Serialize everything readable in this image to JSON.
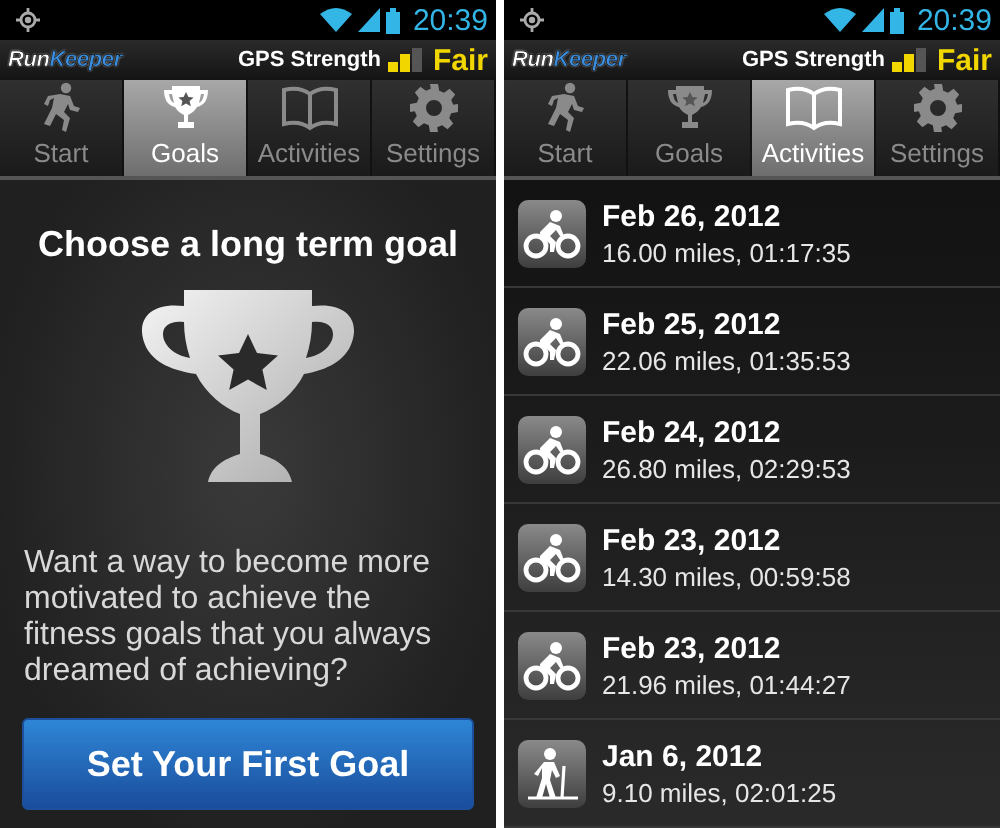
{
  "screens": [
    {
      "status_bar": {
        "time": "20:39"
      },
      "header": {
        "logo": [
          "Run",
          "Keeper"
        ],
        "gps_label": "GPS Strength",
        "gps_status": "Fair"
      },
      "tabs": [
        {
          "label": "Start",
          "kind": "runner",
          "selected": false
        },
        {
          "label": "Goals",
          "kind": "trophy",
          "selected": true
        },
        {
          "label": "Activities",
          "kind": "book",
          "selected": false
        },
        {
          "label": "Settings",
          "kind": "gear",
          "selected": false
        }
      ],
      "content": {
        "kind": "goals",
        "title": "Choose a long term goal",
        "text": "Want a way to become more motivated to achieve the fitness goals that you always dreamed of achieving?",
        "button": "Set Your First Goal"
      }
    },
    {
      "status_bar": {
        "time": "20:39"
      },
      "header": {
        "logo": [
          "Run",
          "Keeper"
        ],
        "gps_label": "GPS Strength",
        "gps_status": "Fair"
      },
      "tabs": [
        {
          "label": "Start",
          "kind": "runner",
          "selected": false
        },
        {
          "label": "Goals",
          "kind": "trophy",
          "selected": false
        },
        {
          "label": "Activities",
          "kind": "book",
          "selected": true
        },
        {
          "label": "Settings",
          "kind": "gear",
          "selected": false
        }
      ],
      "content": {
        "kind": "activities",
        "items": [
          {
            "kind": "cycling",
            "date": "Feb 26, 2012",
            "summary": "16.00 miles, 01:17:35"
          },
          {
            "kind": "cycling",
            "date": "Feb 25, 2012",
            "summary": "22.06 miles, 01:35:53"
          },
          {
            "kind": "cycling",
            "date": "Feb 24, 2012",
            "summary": "26.80 miles, 02:29:53"
          },
          {
            "kind": "cycling",
            "date": "Feb 23, 2012",
            "summary": "14.30 miles, 00:59:58"
          },
          {
            "kind": "cycling",
            "date": "Feb 23, 2012",
            "summary": "21.96 miles, 01:44:27"
          },
          {
            "kind": "hiking",
            "date": "Jan 6, 2012",
            "summary": "9.10 miles, 02:01:25"
          }
        ]
      }
    }
  ]
}
